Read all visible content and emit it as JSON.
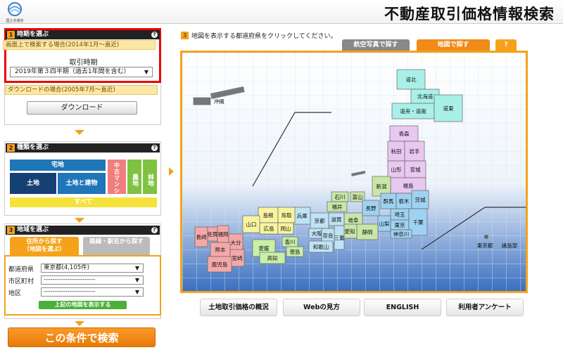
{
  "header": {
    "logo_caption": "国土交通省",
    "title": "不動産取引価格情報検索"
  },
  "step1": {
    "num": "1",
    "title": "時期を選ぶ",
    "help": "?",
    "screen_search": "画面上で検索する場合(2014年1月～直近)",
    "period_label": "取引時期",
    "period_value": "2019年第３四半期（過去1年間を含む）",
    "download_note": "ダウンロードの場合(2005年7月～直近)",
    "download_button": "ダウンロード"
  },
  "step2": {
    "num": "2",
    "title": "種類を選ぶ",
    "help": "?",
    "takuchi": "宅地",
    "tochi": "土地",
    "tochi_tatemono": "土地と建物",
    "chuko": "中古マンション等",
    "nochi": "農地",
    "rinchi": "林地",
    "subete": "すべて"
  },
  "step3": {
    "num": "3",
    "title": "地域を選ぶ",
    "help": "?",
    "tab_address": "住所から探す\n（地図を選ぶ）",
    "tab_line": "路線・駅名から探す",
    "pref_label": "都道府県",
    "pref_value": "東京都(4,105件)",
    "city_label": "市区町村",
    "city_value": "------------------------",
    "district_label": "地区",
    "district_value": "------------------------",
    "map_button": "上記の地図を表示する"
  },
  "search_button": "この条件で検索",
  "map": {
    "num": "3",
    "instruction": "地図を表示する都道府県をクリックしてください。",
    "tab_aerial": "航空写真で探す",
    "tab_map": "地図で探す",
    "tab_help": "?",
    "colors": {
      "hokkaido": "#a8f0e8",
      "tohoku": "#e8c8f0",
      "kanto": "#9fd2f2",
      "chubu": "#c8e6a8",
      "kinki": "#bfe2f5",
      "chugoku": "#f8f4a0",
      "shikoku": "#c8f0a8",
      "kyushu": "#f4a8a8",
      "okinawa": "#777777"
    },
    "regions": {
      "hokkaido": [
        "道北",
        "北海道",
        "道央・道南",
        "道東"
      ],
      "tohoku": [
        "青森",
        "秋田",
        "岩手",
        "山形",
        "宮城",
        "福島"
      ],
      "kanto": [
        "群馬",
        "栃木",
        "茨城",
        "埼玉",
        "東京",
        "千葉",
        "神奈川",
        "山梨",
        "長野"
      ],
      "chubu": [
        "新潟",
        "富山",
        "石川",
        "福井",
        "岐阜",
        "静岡",
        "愛知"
      ],
      "kinki": [
        "滋賀",
        "三重",
        "京都",
        "兵庫",
        "大阪",
        "奈良",
        "和歌山"
      ],
      "chugoku": [
        "島根",
        "鳥取",
        "山口",
        "広島",
        "岡山"
      ],
      "shikoku": [
        "香川",
        "愛媛",
        "徳島",
        "高知"
      ],
      "kyushu": [
        "長崎",
        "佐賀",
        "福岡",
        "大分",
        "熊本",
        "宮崎",
        "鹿児島"
      ],
      "okinawa": [
        "沖縄"
      ],
      "islands": [
        "東京都",
        "諸島部"
      ]
    }
  },
  "bottom_buttons": [
    "土地取引価格の概況",
    "Webの見方",
    "ENGLISH",
    "利用者アンケート"
  ]
}
